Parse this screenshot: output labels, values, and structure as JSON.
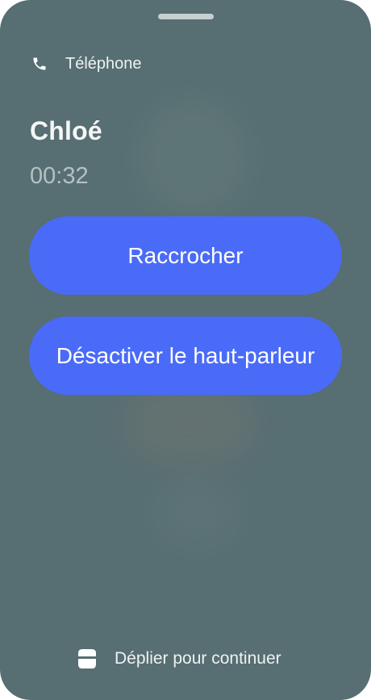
{
  "app": {
    "name": "Téléphone",
    "icon": "phone-icon"
  },
  "call": {
    "caller_name": "Chloé",
    "duration": "00:32"
  },
  "actions": {
    "hang_up_label": "Raccrocher",
    "speaker_label": "Désactiver le haut-parleur"
  },
  "footer": {
    "hint": "Déplier pour continuer",
    "icon": "unfold-device-icon"
  },
  "colors": {
    "background": "#576e72",
    "button": "#4a6bf7",
    "text": "#f1f4f4",
    "timer": "#b4c1c2"
  }
}
